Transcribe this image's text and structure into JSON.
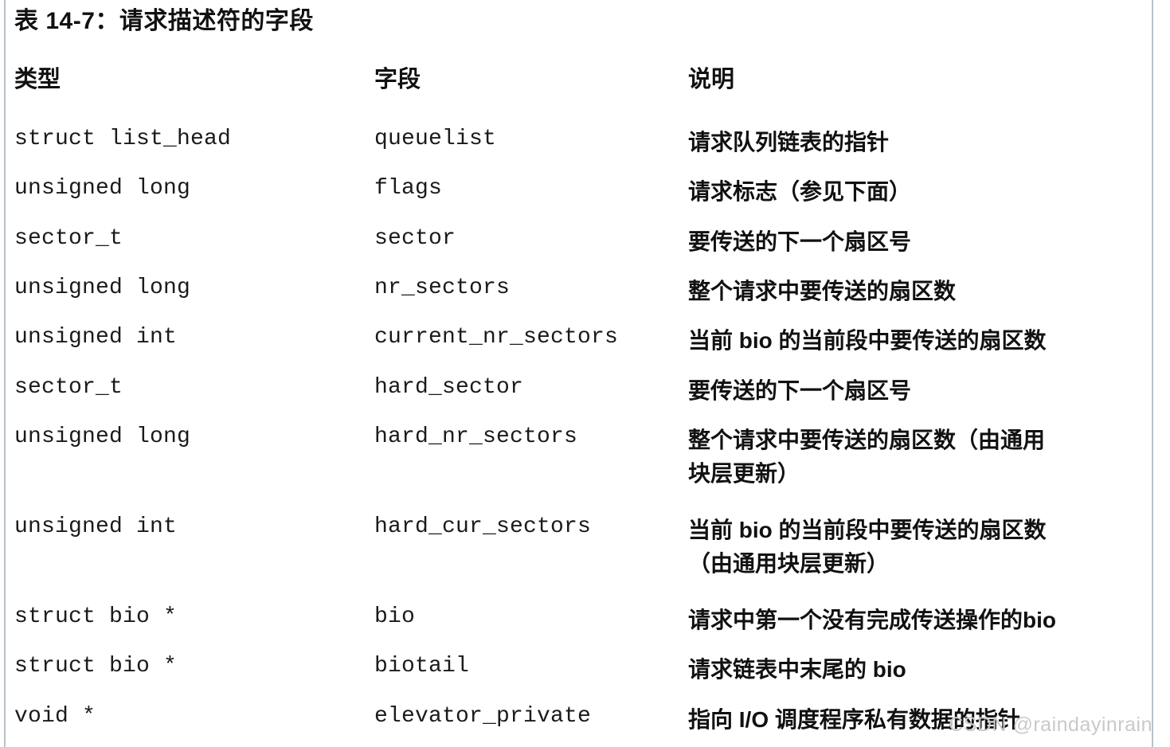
{
  "caption": "表 14-7：请求描述符的字段",
  "table": {
    "headers": {
      "type": "类型",
      "field": "字段",
      "description": "说明"
    },
    "rows": [
      {
        "type": "struct list_head",
        "field": "queuelist",
        "description": "请求队列链表的指针"
      },
      {
        "type": "unsigned long",
        "field": "flags",
        "description": "请求标志（参见下面）"
      },
      {
        "type": "sector_t",
        "field": "sector",
        "description": "要传送的下一个扇区号"
      },
      {
        "type": "unsigned long",
        "field": "nr_sectors",
        "description": "整个请求中要传送的扇区数"
      },
      {
        "type": "unsigned int",
        "field": "current_nr_sectors",
        "description": "当前 bio 的当前段中要传送的扇区数"
      },
      {
        "type": "sector_t",
        "field": "hard_sector",
        "description": "要传送的下一个扇区号"
      },
      {
        "type": "unsigned long",
        "field": "hard_nr_sectors",
        "description": "整个请求中要传送的扇区数（由通用\n块层更新）"
      },
      {
        "type": "unsigned int",
        "field": "hard_cur_sectors",
        "description": "当前 bio 的当前段中要传送的扇区数\n（由通用块层更新）"
      },
      {
        "type": "struct bio *",
        "field": "bio",
        "description": "请求中第一个没有完成传送操作的bio"
      },
      {
        "type": "struct bio *",
        "field": "biotail",
        "description": "请求链表中末尾的 bio"
      },
      {
        "type": "void *",
        "field": "elevator_private",
        "description": "指向 I/O 调度程序私有数据的指针"
      }
    ]
  },
  "watermark": "CSDN @raindayinrain",
  "colors": {
    "rule": "#b9c2ca",
    "text": "#111111",
    "watermark": "#c9c9c9",
    "background": "#ffffff"
  }
}
